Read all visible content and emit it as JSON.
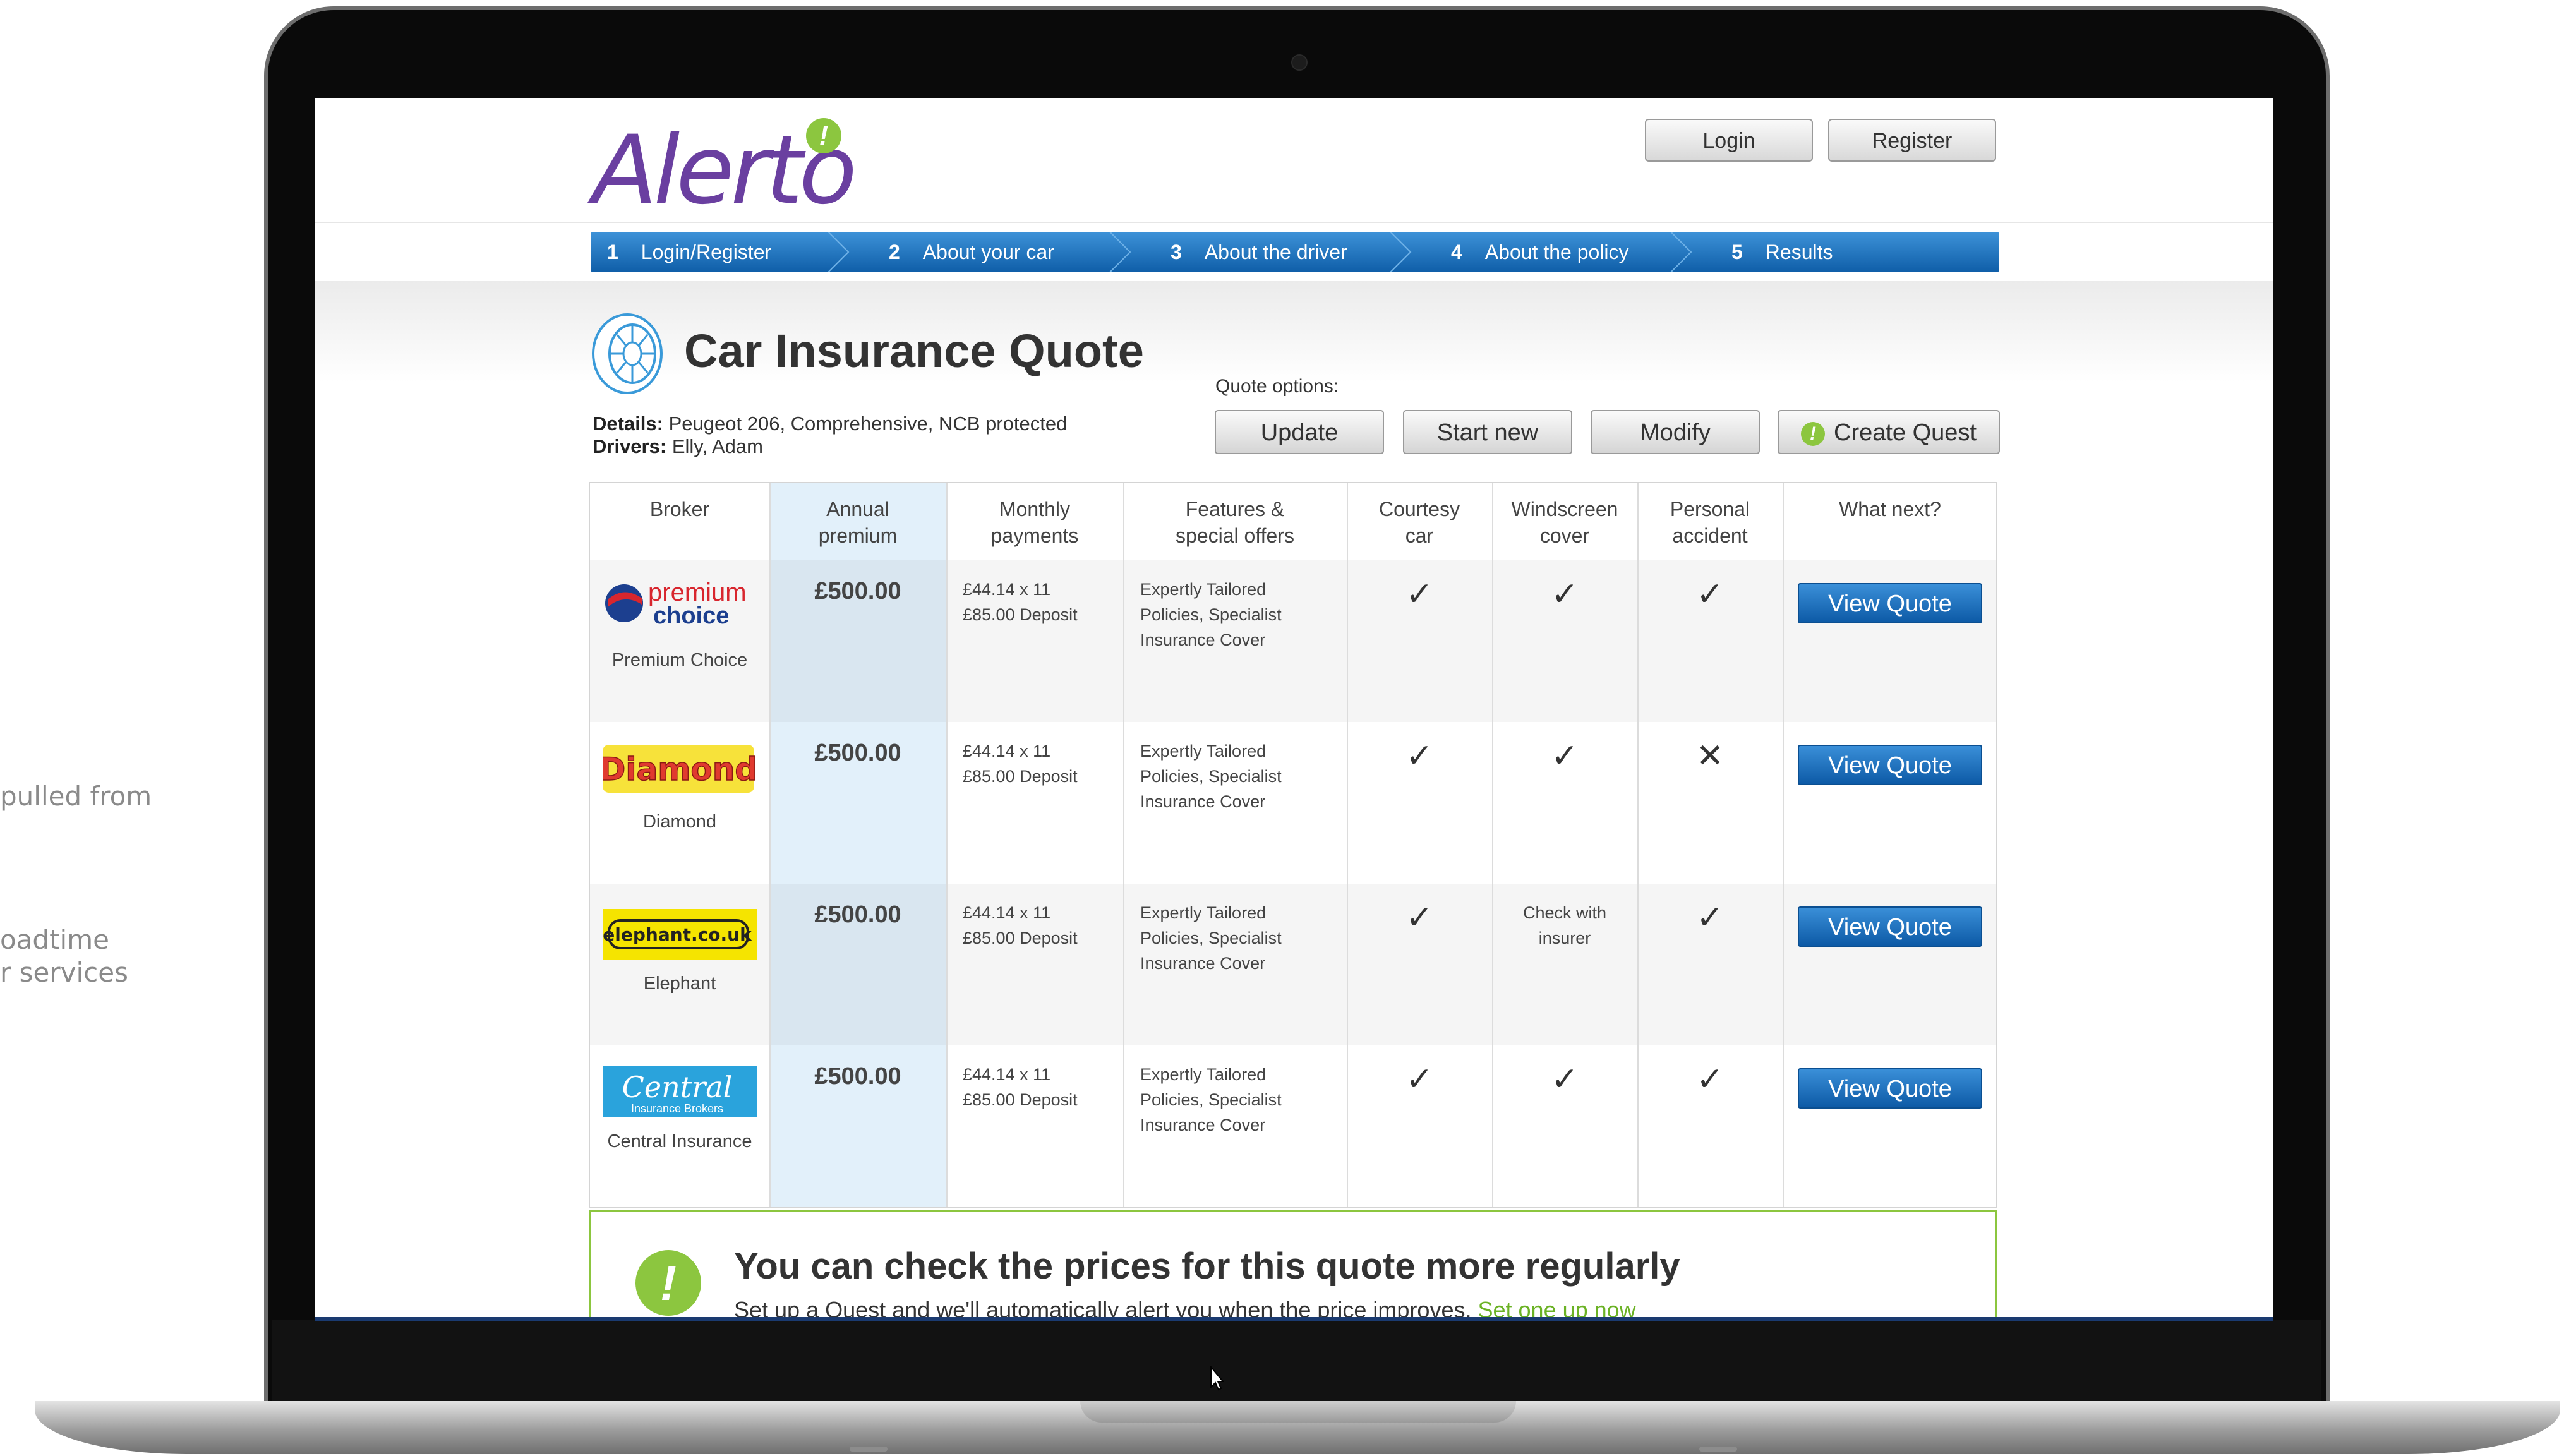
{
  "side_captions": [
    "pulled from",
    "oadtime",
    "r services"
  ],
  "header": {
    "logo_text": "Alerto",
    "logo_mark": "!",
    "login_label": "Login",
    "register_label": "Register"
  },
  "steps": [
    {
      "num": "1",
      "label": "Login/Register"
    },
    {
      "num": "2",
      "label": "About your car"
    },
    {
      "num": "3",
      "label": "About the driver"
    },
    {
      "num": "4",
      "label": "About the policy"
    },
    {
      "num": "5",
      "label": "Results"
    }
  ],
  "page": {
    "title": "Car Insurance Quote",
    "details_label": "Details:",
    "details_value": "Peugeot 206, Comprehensive, NCB protected",
    "drivers_label": "Drivers:",
    "drivers_value": "Elly, Adam",
    "quote_options_label": "Quote options:",
    "buttons": {
      "update": "Update",
      "start_new": "Start new",
      "modify": "Modify",
      "create_quest": "Create Quest"
    }
  },
  "table": {
    "headers": {
      "broker": [
        "Broker"
      ],
      "annual": [
        "Annual",
        "premium"
      ],
      "monthly": [
        "Monthly",
        "payments"
      ],
      "features": [
        "Features &",
        "special offers"
      ],
      "courtesy": [
        "Courtesy",
        "car"
      ],
      "windscreen": [
        "Windscreen",
        "cover"
      ],
      "personal": [
        "Personal",
        "accident"
      ],
      "next": [
        "What next?"
      ]
    },
    "rows": [
      {
        "logo_text": [
          "premium",
          "choice"
        ],
        "broker": "Premium Choice",
        "premium": "£500.00",
        "monthly": [
          "£44.14 x 11",
          "£85.00 Deposit"
        ],
        "features": [
          "Expertly Tailored",
          "Policies, Specialist",
          "Insurance Cover"
        ],
        "courtesy": "✓",
        "windscreen": "✓",
        "personal": "✓",
        "action": "View Quote"
      },
      {
        "logo_text": [
          "Diamond"
        ],
        "broker": "Diamond",
        "premium": "£500.00",
        "monthly": [
          "£44.14 x 11",
          "£85.00 Deposit"
        ],
        "features": [
          "Expertly Tailored",
          "Policies, Specialist",
          "Insurance Cover"
        ],
        "courtesy": "✓",
        "windscreen": "✓",
        "personal": "✕",
        "action": "View Quote"
      },
      {
        "logo_text": [
          "elephant.co.uk"
        ],
        "broker": "Elephant",
        "premium": "£500.00",
        "monthly": [
          "£44.14 x 11",
          "£85.00 Deposit"
        ],
        "features": [
          "Expertly Tailored",
          "Policies, Specialist",
          "Insurance Cover"
        ],
        "courtesy": "✓",
        "windscreen_text": [
          "Check with",
          "insurer"
        ],
        "personal": "✓",
        "action": "View Quote"
      },
      {
        "logo_text": [
          "Central",
          "Insurance Brokers"
        ],
        "broker": "Central Insurance",
        "premium": "£500.00",
        "monthly": [
          "£44.14 x 11",
          "£85.00 Deposit"
        ],
        "features": [
          "Expertly Tailored",
          "Policies, Specialist",
          "Insurance Cover"
        ],
        "courtesy": "✓",
        "windscreen": "✓",
        "personal": "✓",
        "action": "View Quote"
      }
    ]
  },
  "alert": {
    "icon": "!",
    "title": "You can check the prices for this quote more regularly",
    "text": "Set up a Quest and we'll automatically alert you when the price improves.",
    "link": "Set one up now"
  },
  "colors": {
    "accent_blue": "#1a6fc2",
    "brand_green": "#8cc63f",
    "brand_purple": "#6a3fa0",
    "premium_column": "#e2f0fa"
  }
}
